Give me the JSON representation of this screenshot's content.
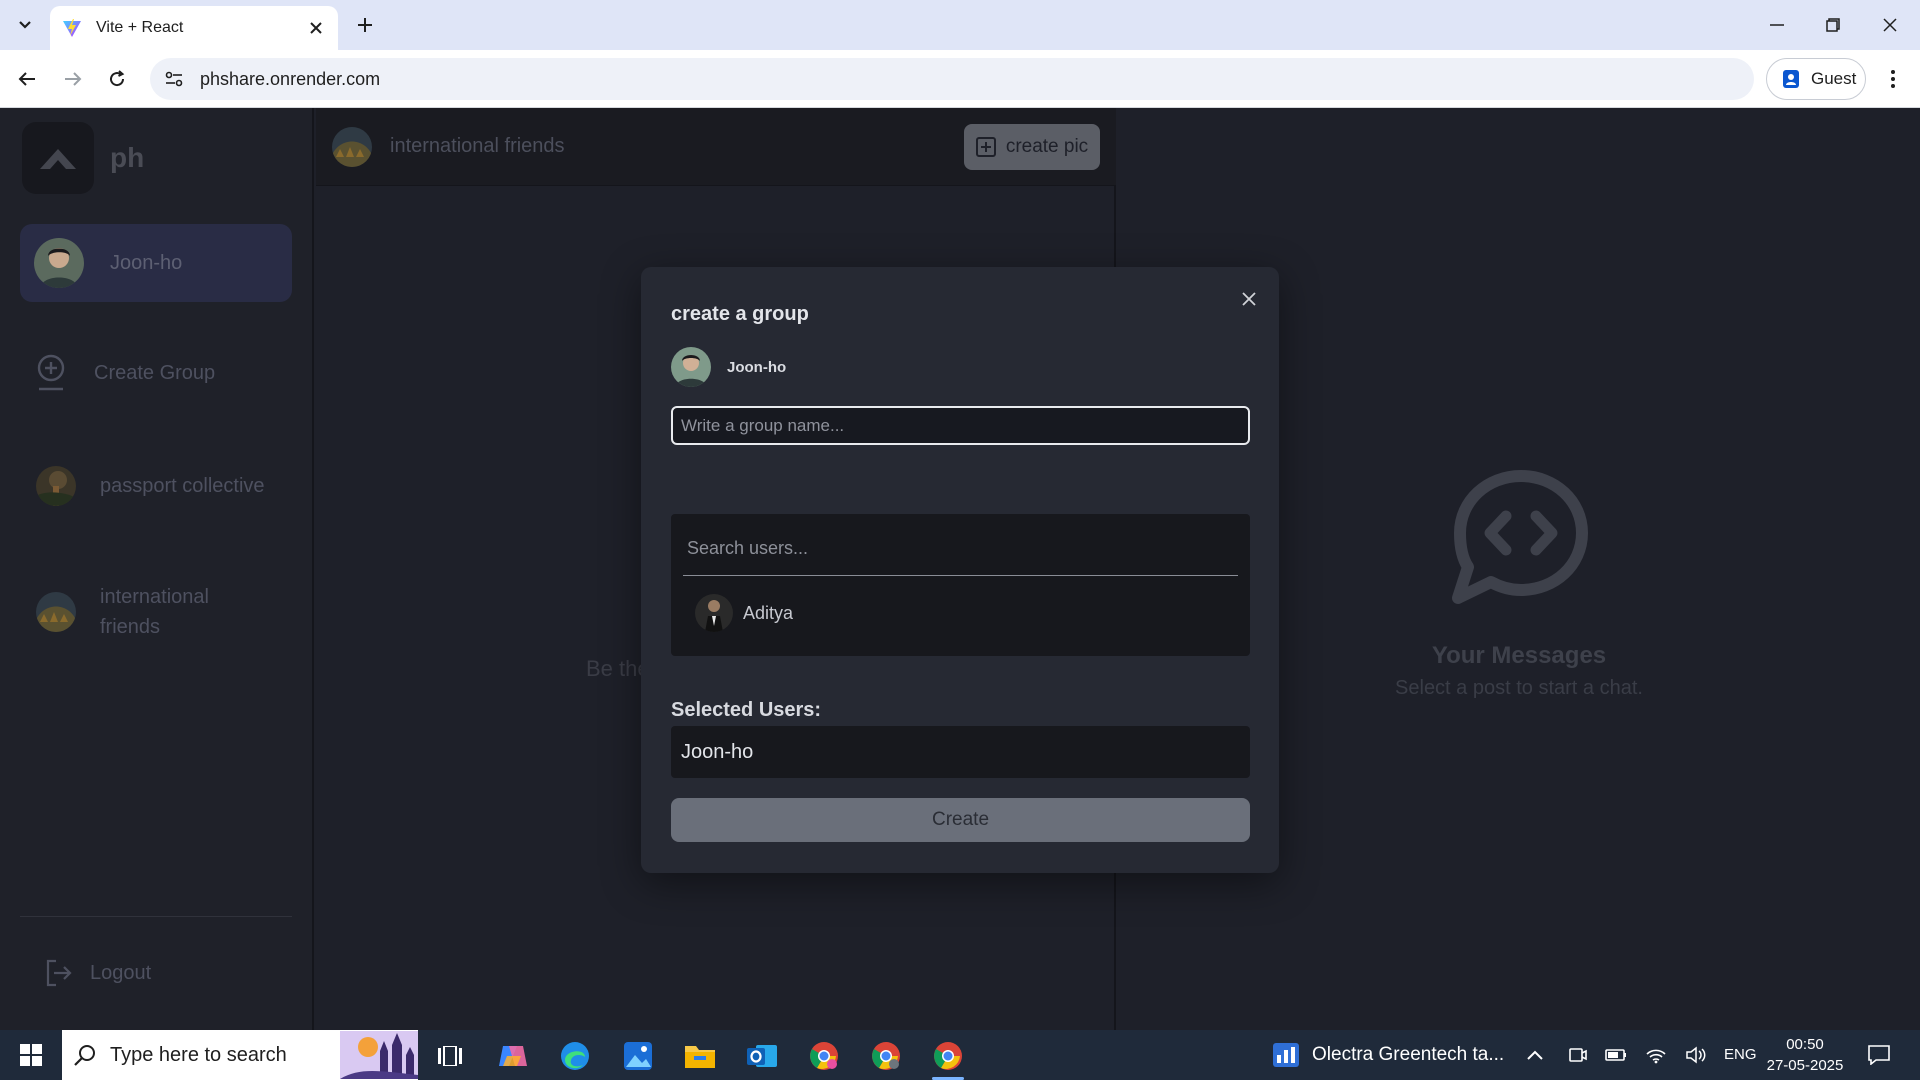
{
  "browser": {
    "tab_title": "Vite + React",
    "url": "phshare.onrender.com",
    "profile_label": "Guest"
  },
  "sidebar": {
    "logo_text": "ph",
    "current_user": "Joon-ho",
    "items": [
      {
        "label": "Create Group",
        "icon": "add-circle-icon"
      },
      {
        "label": "passport collective",
        "icon": "group-avatar"
      },
      {
        "label": "international friends",
        "icon": "group-avatar"
      }
    ],
    "logout_label": "Logout"
  },
  "feed": {
    "group_name": "international friends",
    "create_pic_label": "create pic",
    "empty_text": "Be the"
  },
  "messages": {
    "title": "Your Messages",
    "subtitle": "Select a post to start a chat."
  },
  "modal": {
    "title": "create a group",
    "user_name": "Joon-ho",
    "group_name_placeholder": "Write a group name...",
    "group_name_value": "",
    "search_placeholder": "Search users...",
    "search_results": [
      "Aditya"
    ],
    "selected_label": "Selected Users:",
    "selected_users": [
      "Joon-ho"
    ],
    "create_label": "Create"
  },
  "taskbar": {
    "search_placeholder": "Type here to search",
    "news_text": "Olectra Greentech ta...",
    "language": "ENG",
    "time": "00:50",
    "date": "27-05-2025"
  },
  "colors": {
    "app_bg": "#1e2029",
    "modal_bg": "#262933",
    "user_card_bg": "#292c45",
    "create_button": "#6a6f7a",
    "browser_tabbar": "#dfe5f7",
    "taskbar": "#1f2a3a"
  }
}
